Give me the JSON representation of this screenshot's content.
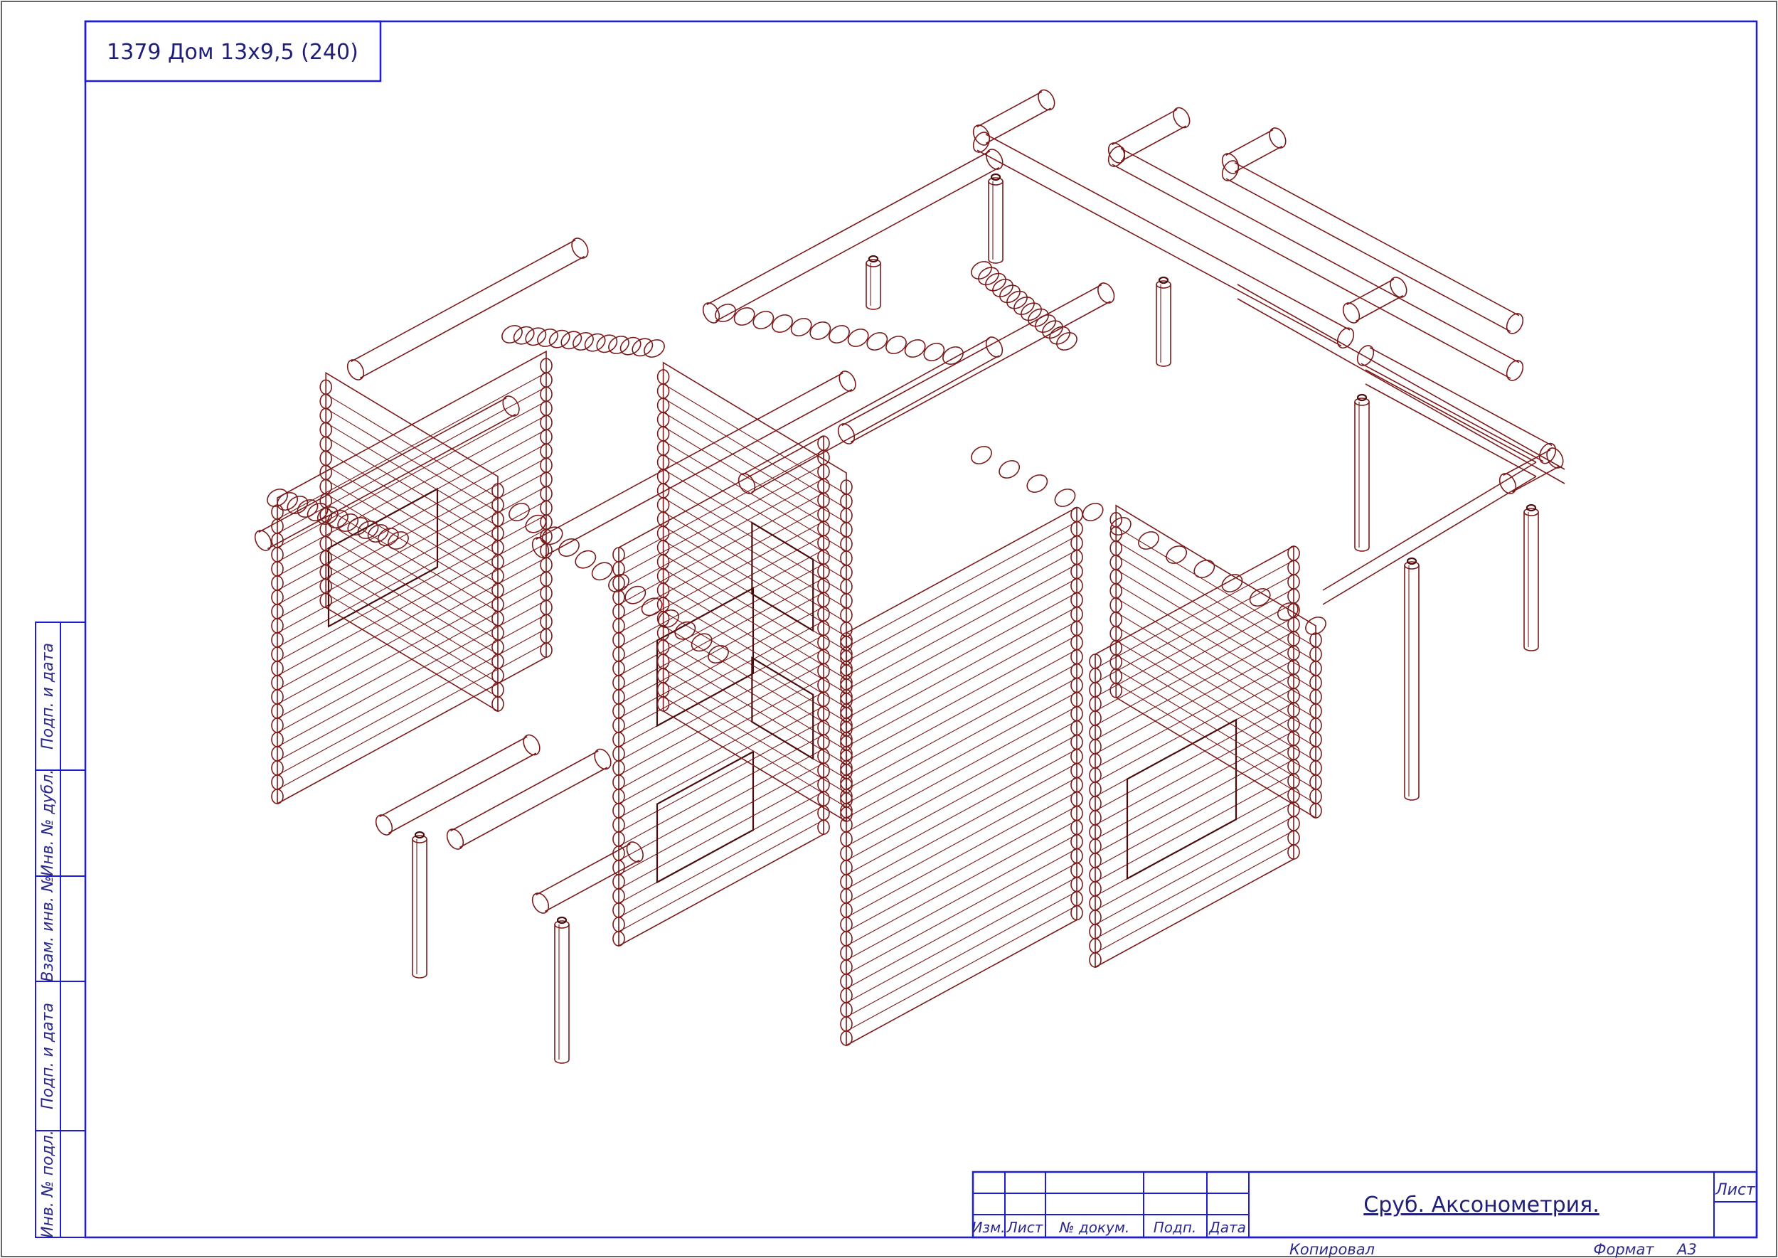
{
  "sheet": {
    "project_title": "1379 Дом 13x9,5 (240)",
    "side_stamp": [
      "Подп. и дата",
      "Инв. № дубл.",
      "Взам. инв. №",
      "Подп. и дата",
      "Инв. № подл."
    ],
    "title_block": {
      "headers": [
        "Изм.",
        "Лист",
        "№ докум.",
        "Подп.",
        "Дата"
      ],
      "drawing_title": "Сруб. Аксонометрия.",
      "sheet_label": "Лист",
      "copied_label": "Копировал",
      "format_label": "Формат",
      "format_value": "А3"
    }
  },
  "colors": {
    "frame": "#1d1dd6",
    "logs": "#7a1a1a",
    "text": "#1f1f7a"
  }
}
